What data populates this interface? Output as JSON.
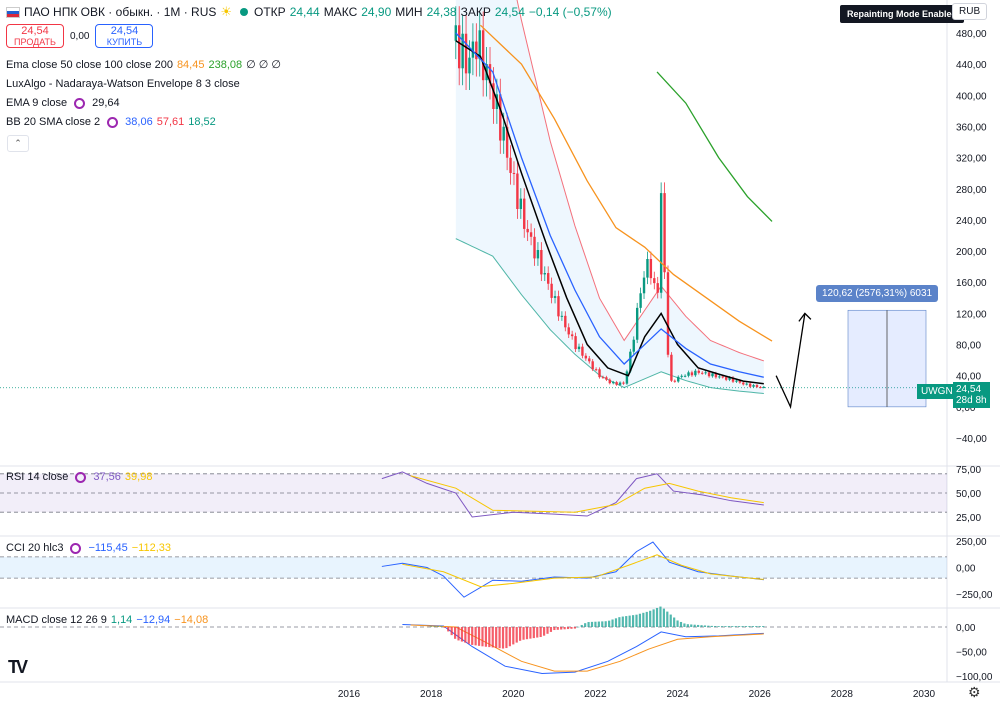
{
  "header": {
    "title": "ПАО НПК ОВК · обыкн. · 1M · RUS",
    "open_label": "ОТКР",
    "open_value": "24,44",
    "high_label": "МАКС",
    "high_value": "24,90",
    "low_label": "МИН",
    "low_value": "24,38",
    "close_label": "ЗАКР",
    "close_value": "24,54",
    "change": "−0,14 (−0,57%)"
  },
  "trade": {
    "sell_price": "24,54",
    "sell_label": "ПРОДАТЬ",
    "spread": "0,00",
    "buy_price": "24,54",
    "buy_label": "КУПИТЬ"
  },
  "indicators": {
    "ema": {
      "label": "Ema close 50 close 100 close 200",
      "v1": "84,45",
      "v2": "238,08",
      "v3": "∅ ∅ ∅"
    },
    "lux": {
      "label": "LuxAlgo - Nadaraya-Watson Envelope 8 3 close"
    },
    "ema9": {
      "label": "EMA 9 close",
      "value": "29,64"
    },
    "bb": {
      "label": "BB 20 SMA close 2",
      "v1": "38,06",
      "v2": "57,61",
      "v3": "18,52"
    },
    "rsi": {
      "label": "RSI 14 close",
      "v1": "37,56",
      "v2": "39,98"
    },
    "cci": {
      "label": "CCI 20 hlc3",
      "v1": "−115,45",
      "v2": "−112,33"
    },
    "macd": {
      "label": "MACD close 12 26 9",
      "v1": "1,14",
      "v2": "−12,94",
      "v3": "−14,08"
    }
  },
  "repaint_badge": "Repainting Mode Enabled",
  "currency": "RUB",
  "symbol_tag": "UWGN",
  "price_tag": {
    "price": "24,54",
    "countdown": "28d 8h"
  },
  "measure_label": "120,62 (2576,31%) 6031",
  "collapse_icon": "chevron-up-icon",
  "logo": "TV",
  "colors": {
    "up": "#089981",
    "down": "#f23645",
    "ema50": "#f7931e",
    "ema100": "#2ba12b",
    "bb": "#2962ff",
    "ema9": "#000000",
    "rsi": "#7e57c2",
    "macd": "#2962ff",
    "signal": "#f7931e"
  },
  "chart_data": [
    {
      "type": "candlestick",
      "title": "ПАО НПК ОВК · обыкн. · 1M · RUS",
      "x_ticks": [
        "2016",
        "2018",
        "2020",
        "2022",
        "2024",
        "2026",
        "2028",
        "2030"
      ],
      "y_ticks": [
        "480,00",
        "440,00",
        "400,00",
        "360,00",
        "320,00",
        "280,00",
        "240,00",
        "200,00",
        "160,00",
        "120,00",
        "80,00",
        "40,00",
        "0,00",
        "−40,00"
      ],
      "ylim": [
        -50,
        490
      ],
      "series": [
        {
          "name": "close",
          "points": [
            [
              2018.6,
              470
            ],
            [
              2018.9,
              440
            ],
            [
              2019.1,
              470
            ],
            [
              2019.4,
              420
            ],
            [
              2019.7,
              360
            ],
            [
              2020.0,
              290
            ],
            [
              2020.3,
              230
            ],
            [
              2020.6,
              190
            ],
            [
              2020.9,
              150
            ],
            [
              2021.2,
              110
            ],
            [
              2021.5,
              80
            ],
            [
              2021.8,
              60
            ],
            [
              2022.1,
              40
            ],
            [
              2022.4,
              30
            ],
            [
              2022.7,
              30
            ],
            [
              2022.9,
              80
            ],
            [
              2023.1,
              150
            ],
            [
              2023.3,
              190
            ],
            [
              2023.5,
              130
            ],
            [
              2023.6,
              270
            ],
            [
              2023.8,
              30
            ],
            [
              2024.1,
              40
            ],
            [
              2024.5,
              45
            ],
            [
              2024.9,
              40
            ],
            [
              2025.3,
              35
            ],
            [
              2025.7,
              28
            ],
            [
              2026.1,
              24.54
            ]
          ]
        },
        {
          "name": "EMA 9",
          "points": [
            [
              2018.6,
              470
            ],
            [
              2019.2,
              450
            ],
            [
              2019.7,
              380
            ],
            [
              2020.2,
              300
            ],
            [
              2020.8,
              210
            ],
            [
              2021.3,
              140
            ],
            [
              2021.8,
              80
            ],
            [
              2022.3,
              50
            ],
            [
              2022.8,
              40
            ],
            [
              2023.2,
              90
            ],
            [
              2023.6,
              120
            ],
            [
              2024.0,
              80
            ],
            [
              2024.5,
              50
            ],
            [
              2025.0,
              42
            ],
            [
              2025.6,
              33
            ],
            [
              2026.1,
              29.64
            ]
          ]
        },
        {
          "name": "BB basis",
          "points": [
            [
              2018.6,
              480
            ],
            [
              2019.5,
              430
            ],
            [
              2020.2,
              320
            ],
            [
              2020.9,
              220
            ],
            [
              2021.5,
              150
            ],
            [
              2022.1,
              90
            ],
            [
              2022.7,
              55
            ],
            [
              2023.2,
              80
            ],
            [
              2023.6,
              100
            ],
            [
              2024.2,
              75
            ],
            [
              2024.8,
              55
            ],
            [
              2025.5,
              45
            ],
            [
              2026.1,
              38.06
            ]
          ]
        },
        {
          "name": "EMA 50",
          "points": [
            [
              2019.2,
              490
            ],
            [
              2020.2,
              440
            ],
            [
              2021.0,
              370
            ],
            [
              2021.8,
              290
            ],
            [
              2022.5,
              230
            ],
            [
              2023.2,
              205
            ],
            [
              2023.9,
              170
            ],
            [
              2024.7,
              140
            ],
            [
              2025.5,
              110
            ],
            [
              2026.3,
              84.45
            ]
          ]
        },
        {
          "name": "EMA 100",
          "points": [
            [
              2023.5,
              430
            ],
            [
              2024.2,
              390
            ],
            [
              2025.0,
              320
            ],
            [
              2025.7,
              270
            ],
            [
              2026.3,
              238.08
            ]
          ]
        }
      ]
    },
    {
      "type": "line",
      "title": "RSI 14 close",
      "y_ticks": [
        "75,00",
        "50,00",
        "25,00"
      ],
      "ylim": [
        15,
        80
      ],
      "series": [
        {
          "name": "RSI",
          "points": [
            [
              2016.8,
              65
            ],
            [
              2017.3,
              72
            ],
            [
              2017.9,
              60
            ],
            [
              2018.6,
              50
            ],
            [
              2019.0,
              25
            ],
            [
              2020.0,
              30
            ],
            [
              2021.0,
              28
            ],
            [
              2021.8,
              26
            ],
            [
              2022.5,
              40
            ],
            [
              2023.0,
              65
            ],
            [
              2023.5,
              70
            ],
            [
              2023.9,
              52
            ],
            [
              2024.6,
              48
            ],
            [
              2025.3,
              42
            ],
            [
              2026.1,
              37.56
            ]
          ]
        },
        {
          "name": "RSI MA",
          "points": [
            [
              2017.5,
              68
            ],
            [
              2018.6,
              55
            ],
            [
              2019.5,
              32
            ],
            [
              2020.5,
              31
            ],
            [
              2021.5,
              30
            ],
            [
              2022.5,
              38
            ],
            [
              2023.2,
              55
            ],
            [
              2023.8,
              60
            ],
            [
              2024.5,
              52
            ],
            [
              2025.3,
              45
            ],
            [
              2026.1,
              39.98
            ]
          ]
        }
      ]
    },
    {
      "type": "line",
      "title": "CCI 20 hlc3",
      "y_ticks": [
        "250,00",
        "0,00",
        "−250,00"
      ],
      "ylim": [
        -330,
        300
      ],
      "series": [
        {
          "name": "CCI",
          "points": [
            [
              2016.8,
              10
            ],
            [
              2017.3,
              40
            ],
            [
              2017.9,
              0
            ],
            [
              2018.3,
              -80
            ],
            [
              2018.8,
              -280
            ],
            [
              2019.5,
              -120
            ],
            [
              2020.2,
              -130
            ],
            [
              2021.0,
              -90
            ],
            [
              2021.8,
              -100
            ],
            [
              2022.5,
              -40
            ],
            [
              2023.0,
              150
            ],
            [
              2023.4,
              240
            ],
            [
              2023.8,
              50
            ],
            [
              2024.5,
              -40
            ],
            [
              2025.3,
              -80
            ],
            [
              2026.1,
              -115.45
            ]
          ]
        },
        {
          "name": "CCI MA",
          "points": [
            [
              2017.3,
              30
            ],
            [
              2018.3,
              -40
            ],
            [
              2019.2,
              -180
            ],
            [
              2020.0,
              -150
            ],
            [
              2021.0,
              -100
            ],
            [
              2022.0,
              -90
            ],
            [
              2022.8,
              20
            ],
            [
              2023.5,
              120
            ],
            [
              2024.1,
              20
            ],
            [
              2024.8,
              -60
            ],
            [
              2025.5,
              -90
            ],
            [
              2026.1,
              -112.33
            ]
          ]
        }
      ]
    },
    {
      "type": "line",
      "title": "MACD close 12 26 9",
      "y_ticks": [
        "0,00",
        "−50,00",
        "−100,00"
      ],
      "ylim": [
        -110,
        15
      ],
      "series": [
        {
          "name": "MACD",
          "points": [
            [
              2017.3,
              5
            ],
            [
              2018.3,
              2
            ],
            [
              2019.0,
              -40
            ],
            [
              2019.8,
              -80
            ],
            [
              2020.7,
              -95
            ],
            [
              2021.5,
              -92
            ],
            [
              2022.3,
              -70
            ],
            [
              2023.0,
              -40
            ],
            [
              2023.6,
              -10
            ],
            [
              2024.2,
              -20
            ],
            [
              2025.0,
              -18
            ],
            [
              2026.1,
              -12.94
            ]
          ]
        },
        {
          "name": "Signal",
          "points": [
            [
              2017.5,
              4
            ],
            [
              2018.6,
              0
            ],
            [
              2019.3,
              -30
            ],
            [
              2020.2,
              -70
            ],
            [
              2021.0,
              -90
            ],
            [
              2021.8,
              -90
            ],
            [
              2022.6,
              -70
            ],
            [
              2023.3,
              -45
            ],
            [
              2024.0,
              -25
            ],
            [
              2024.8,
              -20
            ],
            [
              2026.1,
              -14.08
            ]
          ]
        }
      ]
    }
  ]
}
